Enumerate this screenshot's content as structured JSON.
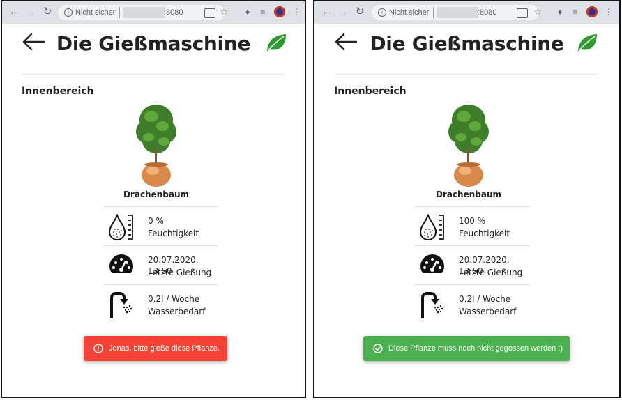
{
  "colors": {
    "chrome_bar": "#dee1e6",
    "leaf": "#2e9b2e",
    "alert_red": "#f44336",
    "alert_green": "#4caf50"
  },
  "icons": {
    "back": "arrow-left-icon",
    "logo": "leaf-icon",
    "humidity": "water-drop-ruler-icon",
    "last_watering": "gauge-icon",
    "water_need": "shower-icon",
    "alert_error": "exclamation-circle-icon",
    "alert_success": "check-circle-icon"
  },
  "panels": [
    {
      "browser": {
        "security_label": "Nicht sicher",
        "url_port": ":8080"
      },
      "app": {
        "title": "Die Gießmaschine",
        "section": "Innenbereich",
        "plant": {
          "name": "Drachenbaum",
          "rows": [
            {
              "value": "0 %",
              "label": "Feuchtigkeit"
            },
            {
              "value": "20.07.2020, 13:50",
              "label": "Letzte Gießung"
            },
            {
              "value": "0,2l / Woche",
              "label": "Wasserbedarf"
            }
          ]
        },
        "alert": {
          "type": "error",
          "text": "Jonas, bitte gieße diese Pflanze."
        }
      }
    },
    {
      "browser": {
        "security_label": "Nicht sicher",
        "url_port": ":8080"
      },
      "app": {
        "title": "Die Gießmaschine",
        "section": "Innenbereich",
        "plant": {
          "name": "Drachenbaum",
          "rows": [
            {
              "value": "100 %",
              "label": "Feuchtigkeit"
            },
            {
              "value": "20.07.2020, 13:50",
              "label": "Letzte Gießung"
            },
            {
              "value": "0,2l / Woche",
              "label": "Wasserbedarf"
            }
          ]
        },
        "alert": {
          "type": "success",
          "text": "Diese Pflanze muss noch nicht gegossen werden :)"
        }
      }
    }
  ]
}
